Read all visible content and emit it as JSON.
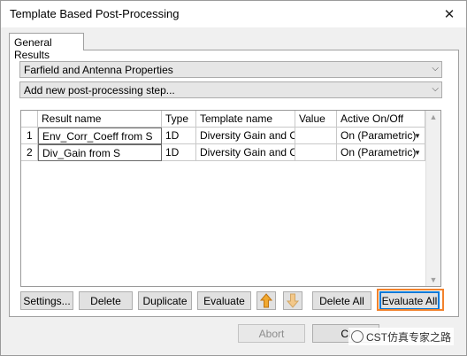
{
  "window": {
    "title": "Template Based Post-Processing",
    "close_glyph": "✕"
  },
  "tabs": [
    {
      "label": "General Results"
    }
  ],
  "combos": {
    "category": {
      "value": "Farfield and Antenna Properties"
    },
    "add_step": {
      "value": "Add new post-processing step..."
    }
  },
  "table": {
    "headers": [
      "Result name",
      "Type",
      "Template name",
      "Value",
      "Active On/Off"
    ],
    "rows": [
      {
        "num": "1",
        "result_name": "Env_Corr_Coeff from S",
        "type": "1D",
        "template": "Diversity Gain and Corre",
        "value": "",
        "active": "On (Parametric)"
      },
      {
        "num": "2",
        "result_name": "Div_Gain from S",
        "type": "1D",
        "template": "Diversity Gain and Corre",
        "value": "",
        "active": "On (Parametric)"
      }
    ]
  },
  "buttons": {
    "settings": "Settings...",
    "delete": "Delete",
    "duplicate": "Duplicate",
    "evaluate": "Evaluate",
    "delete_all": "Delete All",
    "evaluate_all": "Evaluate All"
  },
  "bottom": {
    "abort": "Abort",
    "close": "Cl"
  },
  "watermark": {
    "text": "CST仿真专家之路"
  },
  "colors": {
    "highlight": "#f2822c",
    "move_arrow": "#e8a020"
  }
}
